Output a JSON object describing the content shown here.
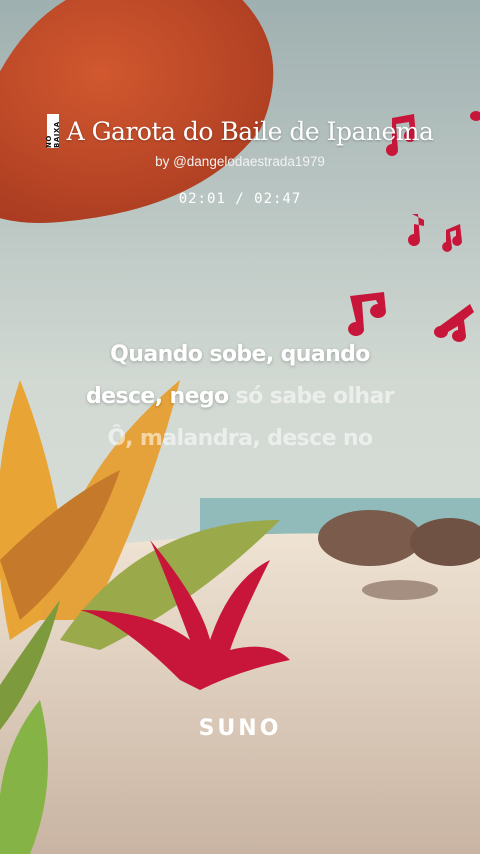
{
  "song": {
    "badge": "NO BAIXA",
    "title": "A Garota do Baile de Ipanema",
    "byline": "by @dangelodaestrada1979"
  },
  "playback": {
    "current": "02:01",
    "separator": " / ",
    "total": "02:47"
  },
  "lyrics": {
    "line1": {
      "sung": "Quando sobe, quando",
      "unsung": ""
    },
    "line2": {
      "sung": "desce, nego ",
      "unsung": "só sabe olhar"
    },
    "line3": {
      "sung": "",
      "unsung": "Ô, malandra, desce no"
    }
  },
  "brand": {
    "logo": "SUNO"
  },
  "colors": {
    "note_red": "#c8163a",
    "umbrella": "#c24a2a",
    "sand": "#e7d6c4",
    "sky": "#c9d3cc"
  }
}
